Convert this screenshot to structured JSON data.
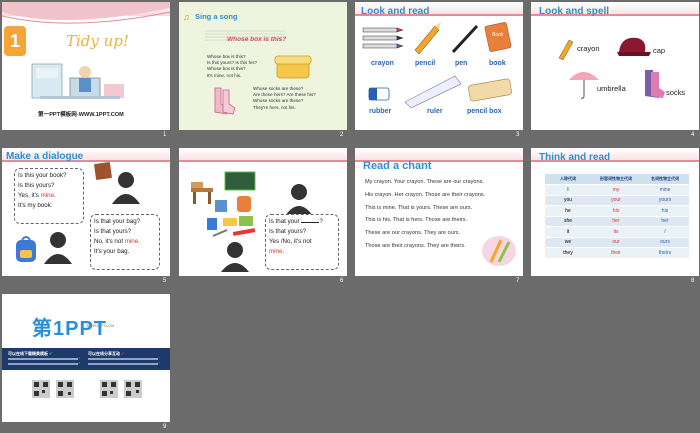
{
  "slides": [
    {
      "num": "1",
      "title": "Tidy up!",
      "badge": "1",
      "footer": "第一PPT模板网-WWW.1PPT.COM"
    },
    {
      "num": "2",
      "header": "Sing a song",
      "song_title": "Whose box is this?",
      "lines_a": [
        "Whose box is this?",
        "Is this yours? Is this his?",
        "Whose box is this?",
        "It's mine, not his."
      ],
      "lines_b": [
        "Whose socks are these?",
        "Are these hers? Are these his?",
        "Whose socks are these?",
        "They're hers, not his."
      ]
    },
    {
      "num": "3",
      "title": "Look and read",
      "labels": [
        "crayon",
        "pencil",
        "pen",
        "book",
        "rubber",
        "ruler",
        "pencil box"
      ],
      "book_cover": "Book"
    },
    {
      "num": "4",
      "title": "Look and spell",
      "labels": [
        "crayon",
        "cap",
        "umbrella",
        "socks"
      ]
    },
    {
      "num": "5",
      "title": "Make a dialogue",
      "q1": [
        "Is this your book?",
        "Is this yours?",
        "Yes, it's ",
        "mine",
        ".",
        "It's my book."
      ],
      "q2": [
        "Is that your bag?",
        "Is that yours?",
        "No, it's not ",
        "mine",
        ".",
        "It's your bag."
      ]
    },
    {
      "num": "6",
      "q": [
        "Is that your ",
        "?",
        "Is that yours?",
        "Yes /No, it's not",
        "mine",
        "."
      ]
    },
    {
      "num": "7",
      "title": "Read a chant",
      "lines": [
        "My crayon. Your crayon. These are our crayons.",
        "His crayon. Her crayon. Those are their crayons.",
        "This is mine. That is yours. These are ours.",
        "This is his. That is hers. Those are theirs.",
        "These are our crayons. They are ours.",
        "Those are their crayons. They are theirs."
      ]
    },
    {
      "num": "8",
      "title": "Think and read",
      "headers": [
        "人称代词",
        "形容词性物主代词",
        "名词性物主代词"
      ],
      "rows": [
        [
          "I",
          "my",
          "mine"
        ],
        [
          "you",
          "your",
          "yours"
        ],
        [
          "he",
          "his",
          "his"
        ],
        [
          "she",
          "her",
          "her"
        ],
        [
          "it",
          "its",
          "/"
        ],
        [
          "we",
          "our",
          "ours"
        ],
        [
          "they",
          "their",
          "theirs"
        ]
      ]
    },
    {
      "num": "9",
      "logo": "第1PPT",
      "logo_sub": "WWW.1PPT.COM",
      "col1": "可以在线下载精美模板",
      "col2": "可以在线分享互动",
      "col1_ticks": [
        "✔",
        "✔",
        "✔"
      ],
      "col2_ticks": [
        "✔",
        "✔",
        "✔"
      ]
    }
  ],
  "colors": {
    "accent_blue": "#2e8fd0",
    "pink": "#e88a96",
    "red": "#e8302c",
    "bg": "#6b6b6b"
  }
}
